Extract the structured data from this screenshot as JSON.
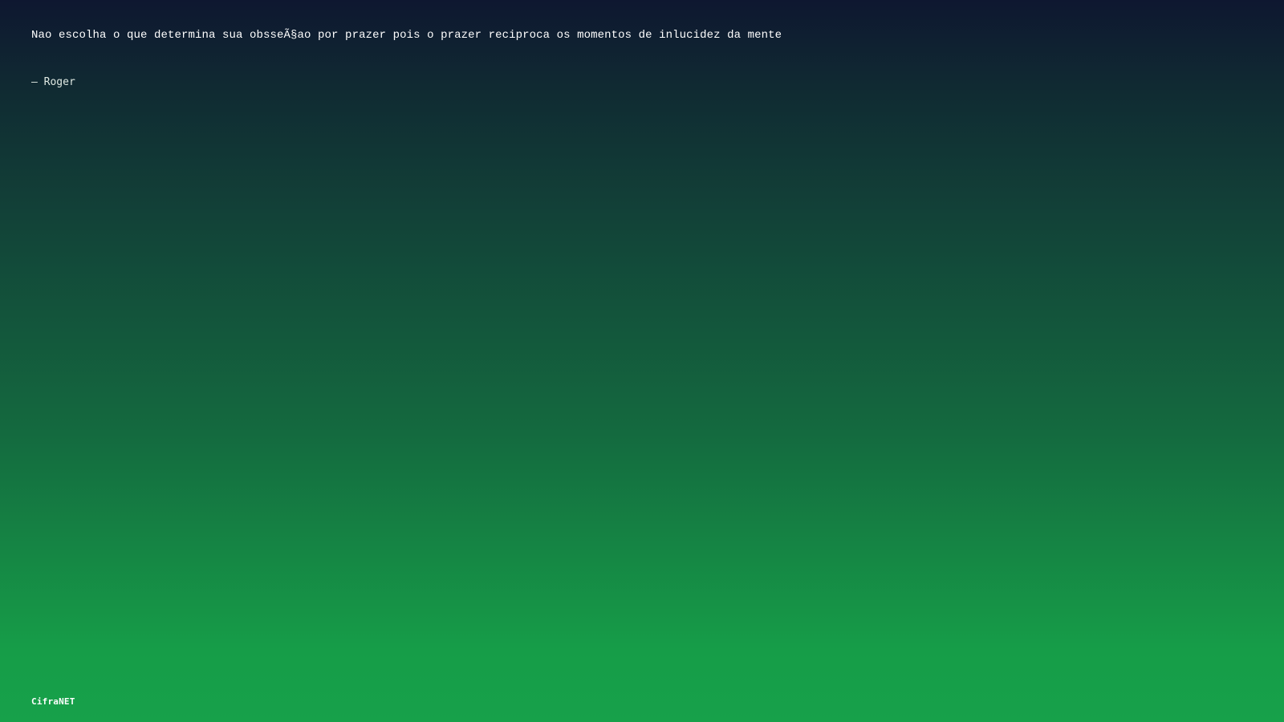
{
  "quote": {
    "text": "Nao escolha o que determina sua obsseÃ§ao por prazer pois o prazer reciproca os momentos de inlucidez da mente",
    "author": "– Roger"
  },
  "footer": {
    "brand": "CifraNET"
  },
  "colors": {
    "background_top": "#0e1730",
    "background_bottom": "#17a14a",
    "text": "#ffffff"
  }
}
